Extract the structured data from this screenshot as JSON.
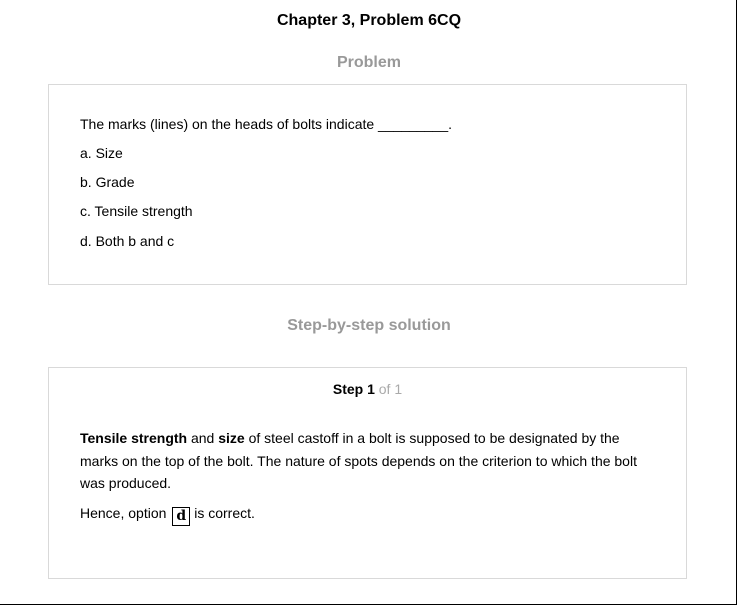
{
  "page": {
    "title": "Chapter 3, Problem 6CQ"
  },
  "problem": {
    "heading": "Problem",
    "question": "The marks (lines) on the heads of bolts indicate _________.",
    "options": [
      "a. Size",
      "b. Grade",
      "c. Tensile strength",
      "d. Both b and c"
    ]
  },
  "solution": {
    "heading": "Step-by-step solution",
    "step_label": "Step 1",
    "step_of": "of 1",
    "bold_term_1": "Tensile strength",
    "connector": "and",
    "bold_term_2": "size",
    "explanation_rest": "of steel castoff in a bolt is supposed to be designated by the marks on the top of the bolt. The nature of spots depends on the criterion to which the bolt was produced.",
    "hence_prefix": "Hence, option",
    "answer": "d",
    "hence_suffix": "is correct."
  }
}
